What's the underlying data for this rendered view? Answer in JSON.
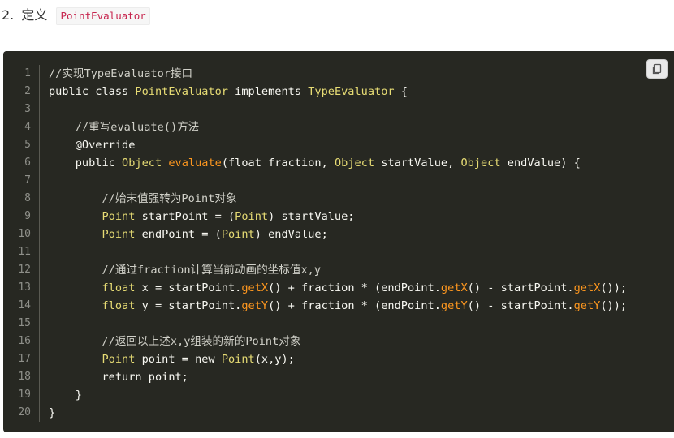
{
  "heading": {
    "number": "2.",
    "text": "定义",
    "code": "PointEvaluator"
  },
  "copy_button": {
    "icon": "copy-icon"
  },
  "colors": {
    "code_background": "#272822",
    "comment": "#d0d0c8",
    "type": "#e6db74",
    "method_call": "#fd971f",
    "text": "#f8f8f2",
    "line_number": "#8f908a",
    "inline_code": "#c7254e"
  },
  "code": {
    "language": "java",
    "lines": [
      {
        "number": "1",
        "tokens": [
          {
            "t": "//实现TypeEvaluator接口",
            "k": "comment"
          }
        ]
      },
      {
        "number": "2",
        "tokens": [
          {
            "t": "public class ",
            "k": "kw"
          },
          {
            "t": "PointEvaluator",
            "k": "type"
          },
          {
            "t": " implements ",
            "k": "kw"
          },
          {
            "t": "TypeEvaluator",
            "k": "type"
          },
          {
            "t": " {",
            "k": "plain"
          }
        ]
      },
      {
        "number": "3",
        "tokens": []
      },
      {
        "number": "4",
        "tokens": [
          {
            "t": "    ",
            "k": "plain"
          },
          {
            "t": "//重写evaluate()方法",
            "k": "comment"
          }
        ]
      },
      {
        "number": "5",
        "tokens": [
          {
            "t": "    ",
            "k": "plain"
          },
          {
            "t": "@Override",
            "k": "ann"
          }
        ]
      },
      {
        "number": "6",
        "tokens": [
          {
            "t": "    public ",
            "k": "kw"
          },
          {
            "t": "Object",
            "k": "type"
          },
          {
            "t": " ",
            "k": "plain"
          },
          {
            "t": "evaluate",
            "k": "call"
          },
          {
            "t": "(float fraction, ",
            "k": "plain"
          },
          {
            "t": "Object",
            "k": "type"
          },
          {
            "t": " startValue, ",
            "k": "plain"
          },
          {
            "t": "Object",
            "k": "type"
          },
          {
            "t": " endValue) {",
            "k": "plain"
          }
        ]
      },
      {
        "number": "7",
        "tokens": []
      },
      {
        "number": "8",
        "tokens": [
          {
            "t": "        ",
            "k": "plain"
          },
          {
            "t": "//始末值强转为Point对象",
            "k": "comment"
          }
        ]
      },
      {
        "number": "9",
        "tokens": [
          {
            "t": "        ",
            "k": "plain"
          },
          {
            "t": "Point",
            "k": "type"
          },
          {
            "t": " startPoint = (",
            "k": "plain"
          },
          {
            "t": "Point",
            "k": "type"
          },
          {
            "t": ") startValue;",
            "k": "plain"
          }
        ]
      },
      {
        "number": "10",
        "tokens": [
          {
            "t": "        ",
            "k": "plain"
          },
          {
            "t": "Point",
            "k": "type"
          },
          {
            "t": " endPoint = (",
            "k": "plain"
          },
          {
            "t": "Point",
            "k": "type"
          },
          {
            "t": ") endValue;",
            "k": "plain"
          }
        ]
      },
      {
        "number": "11",
        "tokens": []
      },
      {
        "number": "12",
        "tokens": [
          {
            "t": "        ",
            "k": "plain"
          },
          {
            "t": "//通过fraction计算当前动画的坐标值x,y",
            "k": "comment"
          }
        ]
      },
      {
        "number": "13",
        "tokens": [
          {
            "t": "        ",
            "k": "plain"
          },
          {
            "t": "float",
            "k": "type"
          },
          {
            "t": " x = startPoint.",
            "k": "plain"
          },
          {
            "t": "getX",
            "k": "call"
          },
          {
            "t": "() + fraction * (endPoint.",
            "k": "plain"
          },
          {
            "t": "getX",
            "k": "call"
          },
          {
            "t": "() - startPoint.",
            "k": "plain"
          },
          {
            "t": "getX",
            "k": "call"
          },
          {
            "t": "());",
            "k": "plain"
          }
        ]
      },
      {
        "number": "14",
        "tokens": [
          {
            "t": "        ",
            "k": "plain"
          },
          {
            "t": "float",
            "k": "type"
          },
          {
            "t": " y = startPoint.",
            "k": "plain"
          },
          {
            "t": "getY",
            "k": "call"
          },
          {
            "t": "() + fraction * (endPoint.",
            "k": "plain"
          },
          {
            "t": "getY",
            "k": "call"
          },
          {
            "t": "() - startPoint.",
            "k": "plain"
          },
          {
            "t": "getY",
            "k": "call"
          },
          {
            "t": "());",
            "k": "plain"
          }
        ]
      },
      {
        "number": "15",
        "tokens": []
      },
      {
        "number": "16",
        "tokens": [
          {
            "t": "        ",
            "k": "plain"
          },
          {
            "t": "//返回以上述x,y组装的新的Point对象",
            "k": "comment"
          }
        ]
      },
      {
        "number": "17",
        "tokens": [
          {
            "t": "        ",
            "k": "plain"
          },
          {
            "t": "Point",
            "k": "type"
          },
          {
            "t": " point = new ",
            "k": "plain"
          },
          {
            "t": "Point",
            "k": "type"
          },
          {
            "t": "(x,y);",
            "k": "plain"
          }
        ]
      },
      {
        "number": "18",
        "tokens": [
          {
            "t": "        return point;",
            "k": "plain"
          }
        ]
      },
      {
        "number": "19",
        "tokens": [
          {
            "t": "    }",
            "k": "plain"
          }
        ]
      },
      {
        "number": "20",
        "tokens": [
          {
            "t": "}",
            "k": "plain"
          }
        ]
      }
    ]
  }
}
